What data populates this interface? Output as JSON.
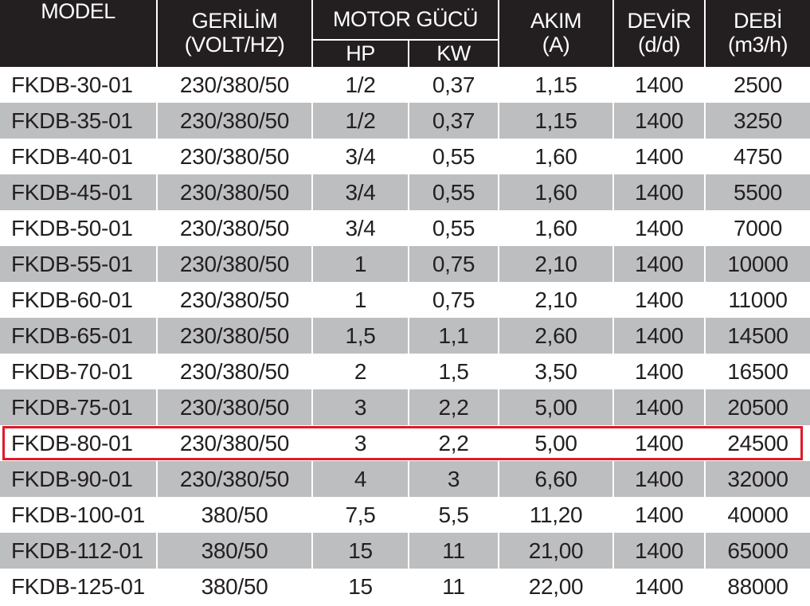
{
  "header": {
    "model": "MODEL",
    "gerilim_line1": "GERİLİM",
    "gerilim_line2": "(VOLT/HZ)",
    "motor_gucu": "MOTOR GÜCÜ",
    "hp": "HP",
    "kw": "KW",
    "akim_line1": "AKIM",
    "akim_line2": "(A)",
    "devir_line1": "DEVİR",
    "devir_line2": "(d/d)",
    "debi_line1": "DEBİ",
    "debi_line2": "(m3/h)"
  },
  "rows": [
    {
      "model": "FKDB-30-01",
      "gerilim": "230/380/50",
      "hp": "1/2",
      "kw": "0,37",
      "akim": "1,15",
      "devir": "1400",
      "debi": "2500"
    },
    {
      "model": "FKDB-35-01",
      "gerilim": "230/380/50",
      "hp": "1/2",
      "kw": "0,37",
      "akim": "1,15",
      "devir": "1400",
      "debi": "3250"
    },
    {
      "model": "FKDB-40-01",
      "gerilim": "230/380/50",
      "hp": "3/4",
      "kw": "0,55",
      "akim": "1,60",
      "devir": "1400",
      "debi": "4750"
    },
    {
      "model": "FKDB-45-01",
      "gerilim": "230/380/50",
      "hp": "3/4",
      "kw": "0,55",
      "akim": "1,60",
      "devir": "1400",
      "debi": "5500"
    },
    {
      "model": "FKDB-50-01",
      "gerilim": "230/380/50",
      "hp": "3/4",
      "kw": "0,55",
      "akim": "1,60",
      "devir": "1400",
      "debi": "7000"
    },
    {
      "model": "FKDB-55-01",
      "gerilim": "230/380/50",
      "hp": "1",
      "kw": "0,75",
      "akim": "2,10",
      "devir": "1400",
      "debi": "10000"
    },
    {
      "model": "FKDB-60-01",
      "gerilim": "230/380/50",
      "hp": "1",
      "kw": "0,75",
      "akim": "2,10",
      "devir": "1400",
      "debi": "11000"
    },
    {
      "model": "FKDB-65-01",
      "gerilim": "230/380/50",
      "hp": "1,5",
      "kw": "1,1",
      "akim": "2,60",
      "devir": "1400",
      "debi": "14500"
    },
    {
      "model": "FKDB-70-01",
      "gerilim": "230/380/50",
      "hp": "2",
      "kw": "1,5",
      "akim": "3,50",
      "devir": "1400",
      "debi": "16500"
    },
    {
      "model": "FKDB-75-01",
      "gerilim": "230/380/50",
      "hp": "3",
      "kw": "2,2",
      "akim": "5,00",
      "devir": "1400",
      "debi": "20500"
    },
    {
      "model": "FKDB-80-01",
      "gerilim": "230/380/50",
      "hp": "3",
      "kw": "2,2",
      "akim": "5,00",
      "devir": "1400",
      "debi": "24500"
    },
    {
      "model": "FKDB-90-01",
      "gerilim": "230/380/50",
      "hp": "4",
      "kw": "3",
      "akim": "6,60",
      "devir": "1400",
      "debi": "32000"
    },
    {
      "model": "FKDB-100-01",
      "gerilim": "380/50",
      "hp": "7,5",
      "kw": "5,5",
      "akim": "11,20",
      "devir": "1400",
      "debi": "40000"
    },
    {
      "model": "FKDB-112-01",
      "gerilim": "380/50",
      "hp": "15",
      "kw": "11",
      "akim": "21,00",
      "devir": "1400",
      "debi": "65000"
    },
    {
      "model": "FKDB-125-01",
      "gerilim": "380/50",
      "hp": "15",
      "kw": "11",
      "akim": "22,00",
      "devir": "1400",
      "debi": "88000"
    }
  ],
  "highlighted_row": "FKDB-80-01",
  "colors": {
    "header_bg": "#231f20",
    "header_text": "#ffffff",
    "stripe_gray": "#bdbec0",
    "highlight_border": "#e0192a"
  }
}
